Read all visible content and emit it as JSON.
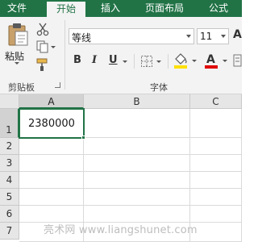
{
  "menu": {
    "tabs": [
      {
        "label": "文件"
      },
      {
        "label": "开始"
      },
      {
        "label": "插入"
      },
      {
        "label": "页面布局"
      },
      {
        "label": "公式"
      }
    ]
  },
  "ribbon": {
    "clipboard": {
      "paste_label": "粘贴",
      "group_label": "剪贴板"
    },
    "font": {
      "font_name": "等线",
      "font_size": "11",
      "bold": "B",
      "italic": "I",
      "underline": "U",
      "group_label": "字体",
      "fill_color": "#ffe000",
      "font_color": "#e00000"
    }
  },
  "sheet": {
    "columns": [
      "A",
      "B",
      "C"
    ],
    "rows": [
      "1",
      "2",
      "3",
      "4",
      "5",
      "6",
      "7"
    ],
    "cells": {
      "A1": "2380000"
    }
  },
  "watermark": "亮术网 www.liangshunet.com",
  "colors": {
    "accent": "#217346"
  }
}
